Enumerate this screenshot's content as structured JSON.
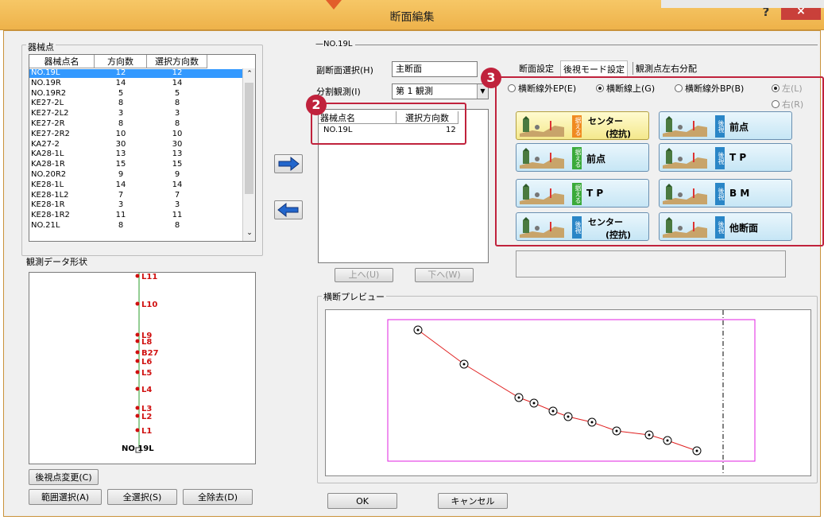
{
  "window": {
    "title": "断面編集",
    "help": "?",
    "close": "×"
  },
  "left": {
    "group_label": "器械点",
    "list_headers": [
      "器械点名",
      "方向数",
      "選択方向数"
    ],
    "rows": [
      [
        "NO.19L",
        "12",
        "12"
      ],
      [
        "NO.19R",
        "14",
        "14"
      ],
      [
        "NO.19R2",
        "5",
        "5"
      ],
      [
        "KE27-2L",
        "8",
        "8"
      ],
      [
        "KE27-2L2",
        "3",
        "3"
      ],
      [
        "KE27-2R",
        "8",
        "8"
      ],
      [
        "KE27-2R2",
        "10",
        "10"
      ],
      [
        "KA27-2",
        "30",
        "30"
      ],
      [
        "KA28-1L",
        "13",
        "13"
      ],
      [
        "KA28-1R",
        "15",
        "15"
      ],
      [
        "NO.20R2",
        "9",
        "9"
      ],
      [
        "KE28-1L",
        "14",
        "14"
      ],
      [
        "KE28-1L2",
        "7",
        "7"
      ],
      [
        "KE28-1R",
        "3",
        "3"
      ],
      [
        "KE28-1R2",
        "11",
        "11"
      ],
      [
        "NO.21L",
        "8",
        "8"
      ]
    ],
    "shape_label": "観測データ形状",
    "shape_points": [
      "L11",
      "L10",
      "L9",
      "L8",
      "B27",
      "L6",
      "L5",
      "L4",
      "L3",
      "L2",
      "L1"
    ],
    "shape_origin": "NO 19L",
    "btn_back_change": "後視点変更(C)",
    "btn_range": "範囲選択(A)",
    "btn_select_all": "全選択(S)",
    "btn_remove_all": "全除去(D)"
  },
  "mid": {
    "section_header": "—NO.19L",
    "sub_section_label": "副断面選択(H)",
    "sub_section_value": "主断面",
    "split_label": "分割観測(I)",
    "split_value": "第 1 観測",
    "sel_headers": [
      "器械点名",
      "選択方向数"
    ],
    "sel_rows": [
      [
        "NO.19L",
        "12"
      ]
    ],
    "btn_up": "上へ(U)",
    "btn_down": "下へ(W)",
    "preview_label": "横断プレビュー",
    "ok": "OK",
    "cancel": "キャンセル"
  },
  "right": {
    "tabs": [
      "断面設定",
      "後視モード設定",
      "観測点左右分配"
    ],
    "radios": [
      "横断線外EP(E)",
      "横断線上(G)",
      "横断線外BP(B)",
      "左(L)",
      "右(R)"
    ],
    "tiles": [
      {
        "tag": "据える",
        "label": "センター",
        "sub": "(控抗)"
      },
      {
        "tag": "後視",
        "label": "前点"
      },
      {
        "tag": "据える",
        "label": "前点"
      },
      {
        "tag": "後視",
        "label": "T P"
      },
      {
        "tag": "据える",
        "label": "T P"
      },
      {
        "tag": "後視",
        "label": "B M"
      },
      {
        "tag": "後視",
        "label": "センター",
        "sub": "(控抗)"
      },
      {
        "tag": "後視",
        "label": "他断面"
      }
    ]
  },
  "badges": [
    "2",
    "3"
  ],
  "colors": {
    "title": "#f0b94f",
    "select": "#3399ff",
    "badge": "#c0223c",
    "preview_frame": "#e020e0",
    "curve": "#e02020",
    "shape_line": "#2a9d2a"
  }
}
